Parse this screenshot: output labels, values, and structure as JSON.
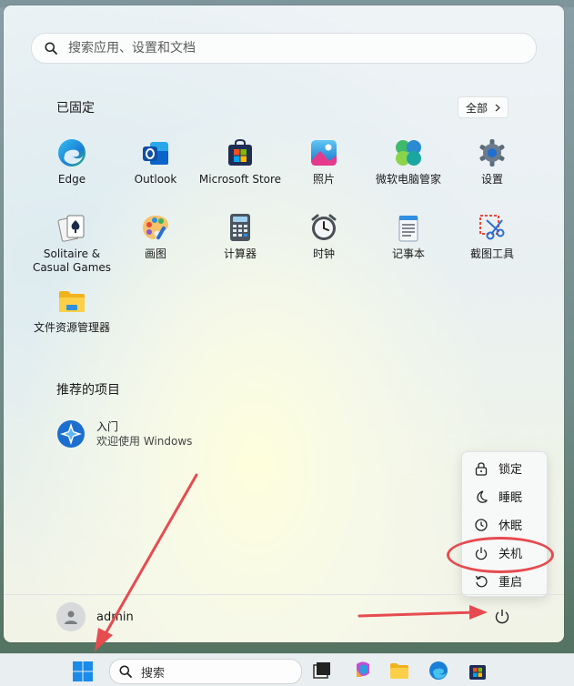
{
  "search": {
    "placeholder": "搜索应用、设置和文档"
  },
  "pinned": {
    "title": "已固定",
    "all_label": "全部",
    "apps": [
      {
        "label": "Edge",
        "icon": "edge-icon"
      },
      {
        "label": "Outlook",
        "icon": "outlook-icon"
      },
      {
        "label": "Microsoft Store",
        "icon": "store-icon"
      },
      {
        "label": "照片",
        "icon": "photos-icon"
      },
      {
        "label": "微软电脑管家",
        "icon": "pc-manager-icon"
      },
      {
        "label": "设置",
        "icon": "settings-gear-icon"
      },
      {
        "label": "Solitaire & Casual Games",
        "icon": "solitaire-icon"
      },
      {
        "label": "画图",
        "icon": "paint-icon"
      },
      {
        "label": "计算器",
        "icon": "calculator-icon"
      },
      {
        "label": "时钟",
        "icon": "clock-icon"
      },
      {
        "label": "记事本",
        "icon": "notepad-icon"
      },
      {
        "label": "截图工具",
        "icon": "snipping-tool-icon"
      },
      {
        "label": "文件资源管理器",
        "icon": "file-explorer-icon"
      }
    ]
  },
  "recommended": {
    "title": "推荐的项目",
    "items": [
      {
        "title": "入门",
        "subtitle": "欢迎使用 Windows",
        "icon": "get-started-icon"
      }
    ]
  },
  "power_menu": {
    "items": [
      {
        "label": "锁定",
        "icon": "lock-icon"
      },
      {
        "label": "睡眠",
        "icon": "moon-icon"
      },
      {
        "label": "休眠",
        "icon": "clock-icon"
      },
      {
        "label": "关机",
        "icon": "power-icon"
      },
      {
        "label": "重启",
        "icon": "restart-icon"
      }
    ],
    "highlighted": "关机"
  },
  "user": {
    "name": "admin"
  },
  "taskbar": {
    "search_label": "搜索"
  },
  "colors": {
    "annotation_red": "#e64b50",
    "accent_blue": "#0f6cbd"
  }
}
